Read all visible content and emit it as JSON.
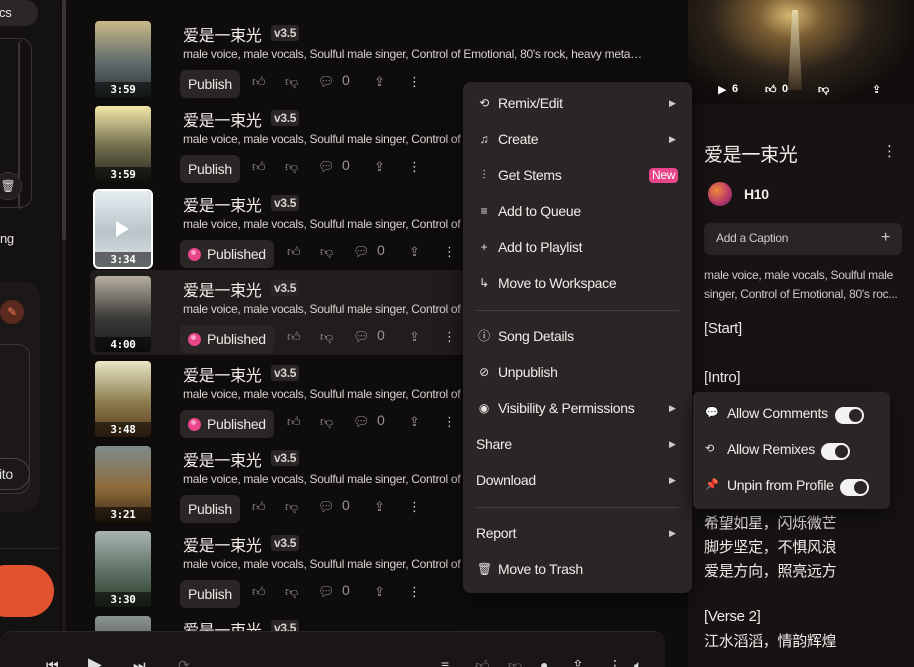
{
  "sidebar": {
    "tab_fragment": "cs",
    "label_fragment": "ng",
    "chip_fragment": "ito"
  },
  "songs": [
    {
      "title": "爱是一束光",
      "version": "v3.5",
      "tags": "male voice, male vocals, Soulful male singer, Control of Emotional, 80's rock, heavy metal, ...",
      "duration": "3:59",
      "status": "Publish",
      "comments": "0"
    },
    {
      "title": "爱是一束光",
      "version": "v3.5",
      "tags": "male voice, male vocals, Soulful male singer, Control of E",
      "duration": "3:59",
      "status": "Publish",
      "comments": "0"
    },
    {
      "title": "爱是一束光",
      "version": "v3.5",
      "tags": "male voice, male vocals, Soulful male singer, Control of E",
      "duration": "3:34",
      "status": "Published",
      "comments": "0"
    },
    {
      "title": "爱是一束光",
      "version": "v3.5",
      "tags": "male voice, male vocals, Soulful male singer, Control of E",
      "duration": "4:00",
      "status": "Published",
      "comments": "0"
    },
    {
      "title": "爱是一束光",
      "version": "v3.5",
      "tags": "male voice, male vocals, Soulful male singer, Control of E",
      "duration": "3:48",
      "status": "Published",
      "comments": "0"
    },
    {
      "title": "爱是一束光",
      "version": "v3.5",
      "tags": "male voice, male vocals, Soulful male singer, Control of E",
      "duration": "3:21",
      "status": "Publish",
      "comments": "0"
    },
    {
      "title": "爱是一束光",
      "version": "v3.5",
      "tags": "male voice, male vocals, Soulful male singer, Control of E",
      "duration": "3:30",
      "status": "Publish",
      "comments": "0"
    },
    {
      "title": "爱是一束光",
      "version": "v3.5",
      "tags": "",
      "duration": "",
      "status": "",
      "comments": ""
    }
  ],
  "thumb_colors": [
    [
      "#c9b98a",
      "#5e6b6a",
      "#2d3436"
    ],
    [
      "#f2e7a8",
      "#6e6a4a",
      "#22261f"
    ],
    [
      "#e6eef2",
      "#b8c4c8",
      "#e0e6ea"
    ],
    [
      "#b7b0a0",
      "#3b3a38",
      "#1c1a18"
    ],
    [
      "#e9e6c6",
      "#8a7b4d",
      "#5d3a20"
    ],
    [
      "#7e8d8c",
      "#8e6a3a",
      "#3a2a18"
    ],
    [
      "#a8b4b0",
      "#5b6e62",
      "#2b3a28"
    ],
    [
      "#8a9490",
      "#4a4a44",
      "#222"
    ]
  ],
  "context_menu": {
    "items": [
      {
        "label": "Remix/Edit",
        "icon": "remix-icon",
        "glyph": "⟲",
        "submenu": true
      },
      {
        "label": "Create",
        "icon": "music-note-icon",
        "glyph": "♫",
        "submenu": true
      },
      {
        "label": "Get Stems",
        "icon": "waveform-icon",
        "glyph": "⫶",
        "badge": "New"
      },
      {
        "label": "Add to Queue",
        "icon": "queue-icon",
        "glyph": "≡"
      },
      {
        "label": "Add to Playlist",
        "icon": "plus-icon",
        "glyph": "+"
      },
      {
        "label": "Move to Workspace",
        "icon": "arrow-turn-icon",
        "glyph": "↳"
      },
      {
        "label": "Song Details",
        "icon": "info-icon",
        "glyph": "ⓘ"
      },
      {
        "label": "Unpublish",
        "icon": "unpublish-icon",
        "glyph": "⊘"
      },
      {
        "label": "Visibility & Permissions",
        "icon": "eye-icon",
        "glyph": "◉",
        "submenu": true
      },
      {
        "label": "Share",
        "submenu": true
      },
      {
        "label": "Download",
        "submenu": true
      },
      {
        "label": "Report",
        "submenu": true
      },
      {
        "label": "Move to Trash",
        "icon": "trash-icon",
        "glyph": "🗑"
      }
    ]
  },
  "visibility_submenu": {
    "items": [
      {
        "label": "Allow Comments",
        "icon": "comment-icon",
        "glyph": "💬",
        "on": true
      },
      {
        "label": "Allow Remixes",
        "icon": "remix-icon",
        "glyph": "⟲",
        "on": true
      },
      {
        "label": "Unpin from Profile",
        "icon": "pin-icon",
        "glyph": "📌",
        "on": true
      }
    ]
  },
  "details": {
    "plays": "6",
    "likes": "0",
    "title": "爱是一束光",
    "user": "H10",
    "caption_placeholder": "Add a Caption",
    "tags": "male voice, male vocals, Soulful male singer, Control of Emotional, 80's roc...",
    "lyrics": [
      "[Start]",
      "[Intro]",
      "希望如星，闪烁微芒",
      "脚步坚定，不惧风浪",
      "爱是方向，照亮远方",
      "[Verse 2]",
      "江水滔滔，情韵辉煌"
    ]
  },
  "colors": {
    "accent": "#e8458a",
    "create_button": "#e0532e",
    "menu_bg": "#2b2626",
    "page_bg": "#0f0c0c"
  }
}
